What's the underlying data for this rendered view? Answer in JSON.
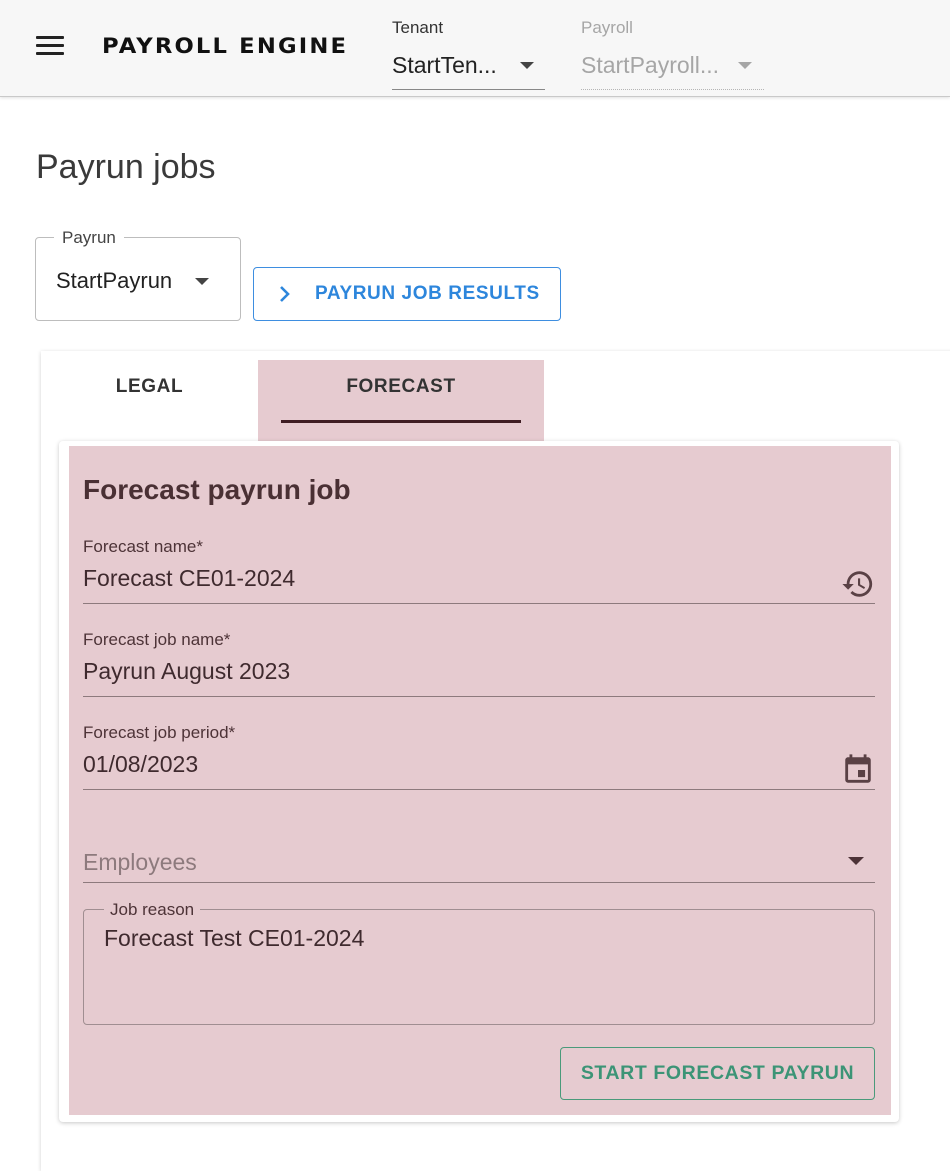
{
  "app": {
    "title": "PAYROLL ENGINE"
  },
  "header": {
    "tenant": {
      "label": "Tenant",
      "value": "StartTen..."
    },
    "payroll": {
      "label": "Payroll",
      "value": "StartPayroll..."
    }
  },
  "page": {
    "title": "Payrun jobs"
  },
  "payrun": {
    "label": "Payrun",
    "value": "StartPayrun"
  },
  "results_button": {
    "label": "PAYRUN JOB RESULTS"
  },
  "tabs": [
    {
      "label": "LEGAL",
      "active": false
    },
    {
      "label": "FORECAST",
      "active": true
    }
  ],
  "form": {
    "title": "Forecast payrun job",
    "forecast_name": {
      "label": "Forecast name*",
      "value": "Forecast CE01-2024"
    },
    "forecast_job_name": {
      "label": "Forecast job name*",
      "value": "Payrun August 2023"
    },
    "forecast_job_period": {
      "label": "Forecast job period*",
      "value": "01/08/2023"
    },
    "employees": {
      "placeholder": "Employees"
    },
    "job_reason": {
      "label": "Job reason",
      "value": "Forecast Test CE01-2024"
    },
    "start_button": "START FORECAST PAYRUN"
  },
  "colors": {
    "accent_blue": "#2d86dc",
    "panel_background": "#e6cbd0",
    "tab_indicator": "#3f1d23",
    "start_button": "#3c9476"
  }
}
